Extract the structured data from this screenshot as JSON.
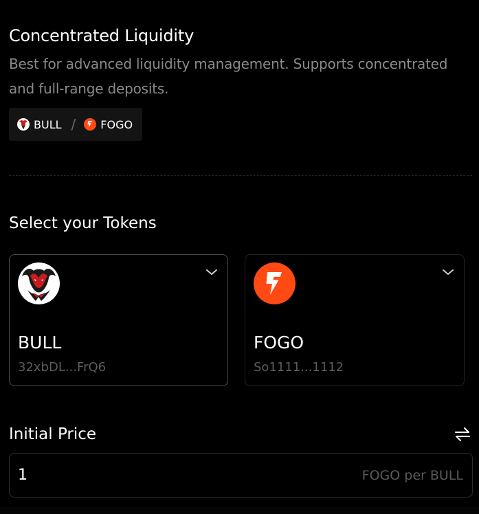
{
  "header": {
    "title": "Concentrated Liquidity",
    "subtitle": "Best for advanced liquidity management. Supports concentrated and full-range deposits."
  },
  "pair": {
    "base_symbol": "BULL",
    "separator": "/",
    "quote_symbol": "FOGO",
    "base_icon": "bull-logo-icon",
    "quote_icon": "fogo-logo-icon"
  },
  "token_select": {
    "title": "Select your Tokens",
    "tokens": [
      {
        "symbol": "BULL",
        "address": "32xbDL...FrQ6",
        "icon": "bull-logo-icon",
        "selected": true
      },
      {
        "symbol": "FOGO",
        "address": "So1111...1112",
        "icon": "fogo-logo-icon",
        "selected": false
      }
    ]
  },
  "initial_price": {
    "title": "Initial Price",
    "value": "1",
    "unit": "FOGO per BULL",
    "swap_icon": "swap-arrows-icon"
  },
  "colors": {
    "background": "#000000",
    "text_primary": "#ffffff",
    "text_secondary": "#8a8a8a",
    "fogo_orange": "#ff4a14",
    "bull_red": "#c41e1e"
  }
}
